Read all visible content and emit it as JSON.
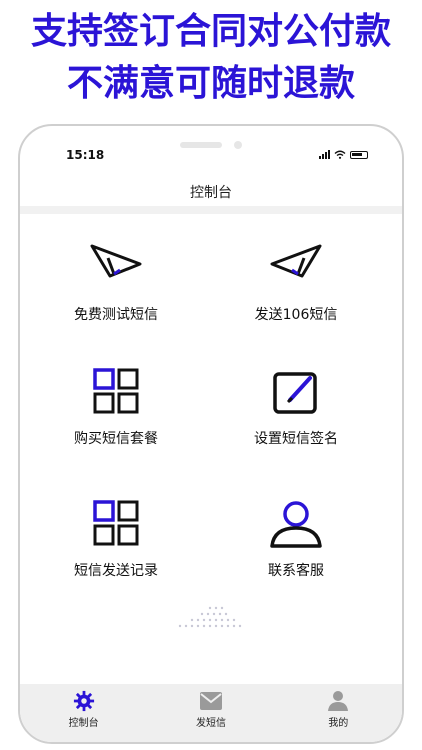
{
  "banner": {
    "line1": "支持签订合同对公付款",
    "line2": "不满意可随时退款"
  },
  "status_bar": {
    "time": "15:18"
  },
  "header": {
    "title": "控制台"
  },
  "menu": {
    "items": [
      {
        "label": "免费测试短信",
        "icon": "send-icon"
      },
      {
        "label": "发送106短信",
        "icon": "send-icon"
      },
      {
        "label": "购买短信套餐",
        "icon": "grid-icon"
      },
      {
        "label": "设置短信签名",
        "icon": "edit-icon"
      },
      {
        "label": "短信发送记录",
        "icon": "grid-icon"
      },
      {
        "label": "联系客服",
        "icon": "user-icon"
      }
    ]
  },
  "tabbar": {
    "items": [
      {
        "label": "控制台",
        "icon": "gear-icon",
        "active": true
      },
      {
        "label": "发短信",
        "icon": "mail-icon",
        "active": false
      },
      {
        "label": "我的",
        "icon": "person-icon",
        "active": false
      }
    ]
  },
  "colors": {
    "accent": "#2b14d6",
    "text": "#111111",
    "tab_inactive": "#9a9a9a"
  }
}
